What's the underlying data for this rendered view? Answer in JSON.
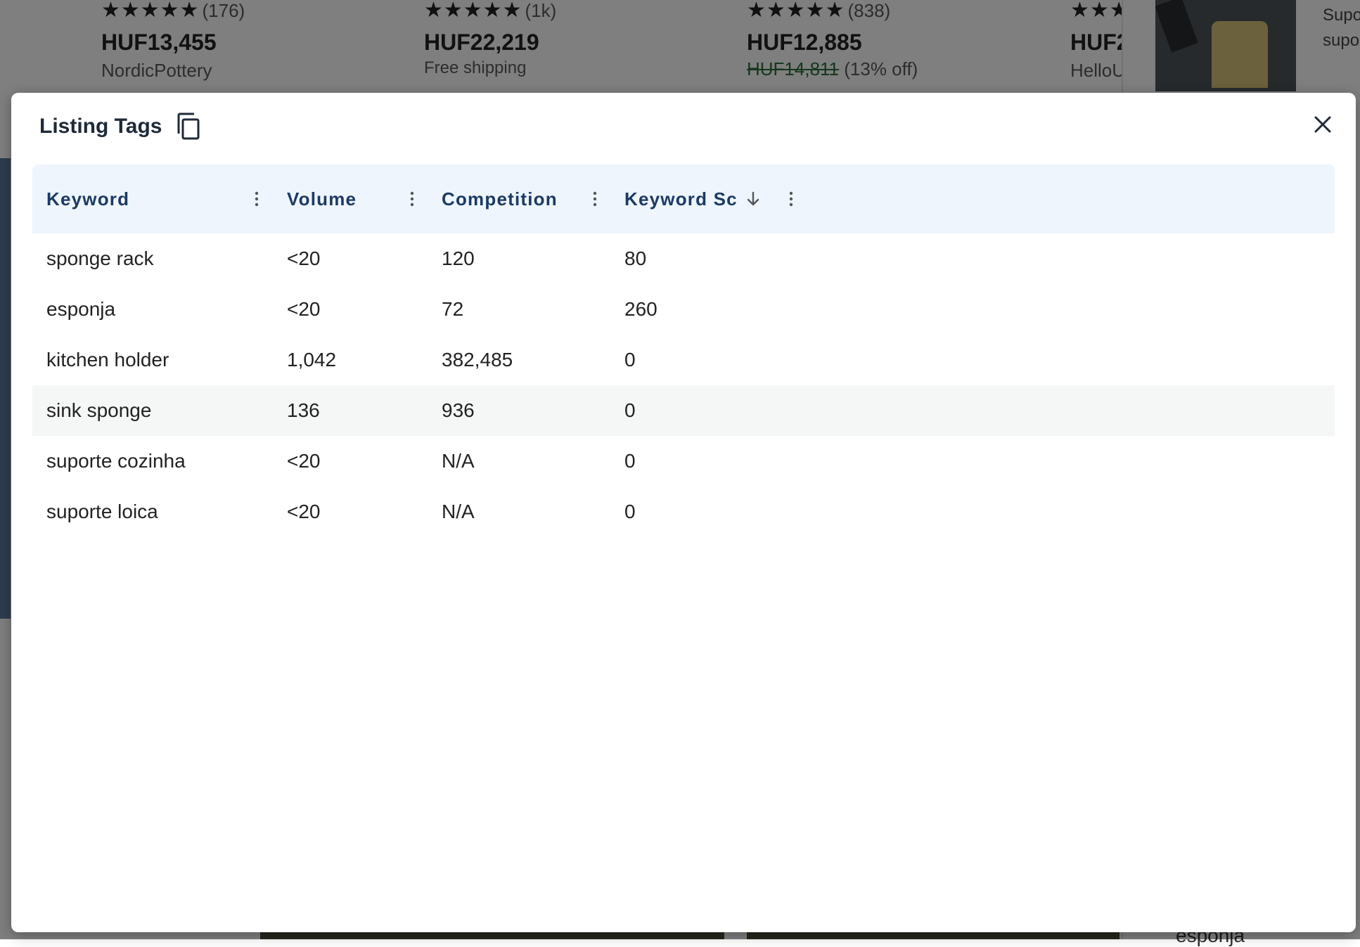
{
  "background": {
    "cards": [
      {
        "rating_count": "(176)",
        "price": "HUF13,455",
        "shop": "NordicPottery"
      },
      {
        "rating_count": "(1k)",
        "price": "HUF22,219",
        "shipping": "Free shipping"
      },
      {
        "rating_count": "(838)",
        "price": "HUF12,885",
        "original_price": "HUF14,811",
        "discount": "(13% off)"
      },
      {
        "price": "HUF2",
        "shop": "HelloU"
      }
    ],
    "right_panel_text": [
      "Supo",
      "supo"
    ],
    "bottom_text": "esponja"
  },
  "modal": {
    "title": "Listing Tags",
    "columns": [
      "Keyword",
      "Volume",
      "Competition",
      "Keyword Sc"
    ],
    "rows": [
      {
        "keyword": "sponge rack",
        "volume": "<20",
        "competition": "120",
        "score": "80"
      },
      {
        "keyword": "esponja",
        "volume": "<20",
        "competition": "72",
        "score": "260"
      },
      {
        "keyword": "kitchen holder",
        "volume": "1,042",
        "competition": "382,485",
        "score": "0"
      },
      {
        "keyword": "sink sponge",
        "volume": "136",
        "competition": "936",
        "score": "0"
      },
      {
        "keyword": "suporte cozinha",
        "volume": "<20",
        "competition": "N/A",
        "score": "0"
      },
      {
        "keyword": "suporte loica",
        "volume": "<20",
        "competition": "N/A",
        "score": "0"
      }
    ]
  },
  "colors": {
    "header_bg": "#eef5fd",
    "header_text": "#1c3a63",
    "row_hover": "#f5f7f7",
    "overlay": "rgba(0,0,0,0.5)"
  },
  "icons": [
    "star-icon",
    "copy-icon",
    "close-icon",
    "column-menu-icon",
    "sort-descending-icon"
  ]
}
